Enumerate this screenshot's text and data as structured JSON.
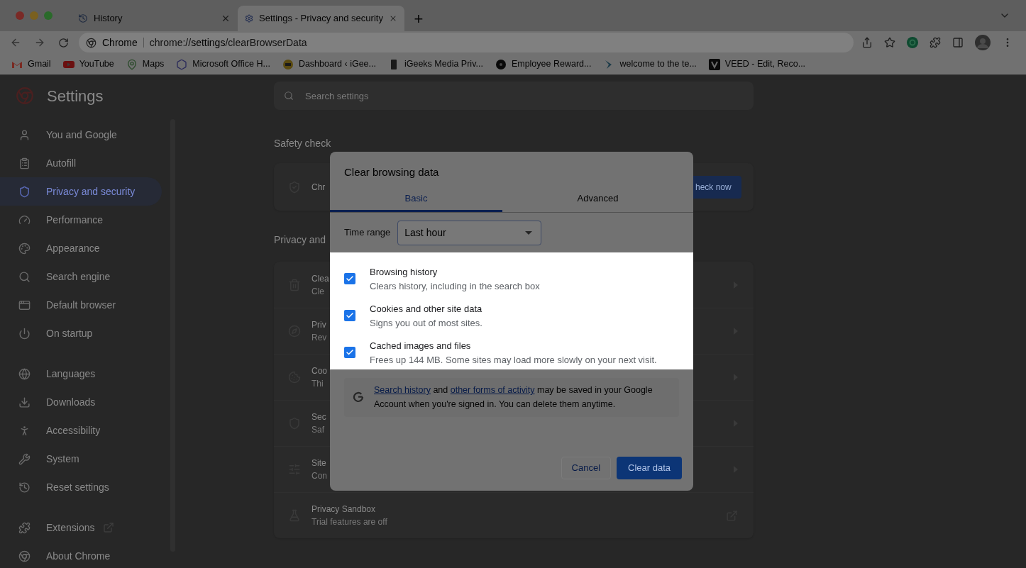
{
  "browser": {
    "tabs": [
      {
        "title": "History",
        "selected": false
      },
      {
        "title": "Settings - Privacy and security",
        "selected": true
      }
    ],
    "new_tab": "+",
    "address": {
      "site": "Chrome",
      "url": "chrome://**settings**/clearBrowserData"
    },
    "bookmarks": [
      {
        "title": "Gmail"
      },
      {
        "title": "YouTube"
      },
      {
        "title": "Maps"
      },
      {
        "title": "Microsoft Office H..."
      },
      {
        "title": "Dashboard ‹ iGee..."
      },
      {
        "title": "iGeeks Media Priv..."
      },
      {
        "title": "Employee Reward..."
      },
      {
        "title": "welcome to the te..."
      },
      {
        "title": "VEED - Edit, Reco..."
      }
    ]
  },
  "settings": {
    "title": "Settings",
    "search_placeholder": "Search settings",
    "sidebar_groups": [
      [
        {
          "label": "You and Google",
          "selected": false,
          "external": false
        },
        {
          "label": "Autofill",
          "selected": false,
          "external": false
        },
        {
          "label": "Privacy and security",
          "selected": true,
          "external": false
        },
        {
          "label": "Performance",
          "selected": false,
          "external": false
        },
        {
          "label": "Appearance",
          "selected": false,
          "external": false
        },
        {
          "label": "Search engine",
          "selected": false,
          "external": false
        },
        {
          "label": "Default browser",
          "selected": false,
          "external": false
        },
        {
          "label": "On startup",
          "selected": false,
          "external": false
        }
      ],
      [
        {
          "label": "Languages",
          "selected": false,
          "external": false
        },
        {
          "label": "Downloads",
          "selected": false,
          "external": false
        },
        {
          "label": "Accessibility",
          "selected": false,
          "external": false
        },
        {
          "label": "System",
          "selected": false,
          "external": false
        },
        {
          "label": "Reset settings",
          "selected": false,
          "external": false
        }
      ],
      [
        {
          "label": "Extensions",
          "selected": false,
          "external": true
        },
        {
          "label": "About Chrome",
          "selected": false,
          "external": false
        }
      ]
    ],
    "safety_check": {
      "heading": "Safety check",
      "row_title": "Chr",
      "button": "heck now"
    },
    "privacy": {
      "heading": "Privacy and",
      "rows": [
        {
          "title": "Clea",
          "subtitle": "Cle",
          "kind": "arrow"
        },
        {
          "title": "Priv",
          "subtitle": "Rev",
          "kind": "arrow"
        },
        {
          "title": "Coo",
          "subtitle": "Thi",
          "kind": "arrow"
        },
        {
          "title": "Sec",
          "subtitle": "Saf",
          "kind": "arrow"
        },
        {
          "title": "Site",
          "subtitle": "Con",
          "kind": "arrow"
        },
        {
          "title": "Privacy Sandbox",
          "subtitle": "Trial features are off",
          "kind": "external"
        }
      ]
    }
  },
  "dialog": {
    "title": "Clear browsing data",
    "tabs": [
      {
        "label": "Basic",
        "selected": true
      },
      {
        "label": "Advanced",
        "selected": false
      }
    ],
    "time_range": {
      "label": "Time range",
      "value": "Last hour"
    },
    "options": [
      {
        "title": "Browsing history",
        "description": "Clears history, including in the search box",
        "checked": true
      },
      {
        "title": "Cookies and other site data",
        "description": "Signs you out of most sites.",
        "checked": true
      },
      {
        "title": "Cached images and files",
        "description": "Frees up 144 MB. Some sites may load more slowly on your next visit.",
        "checked": true
      }
    ],
    "info": [
      {
        "kind": "link",
        "text": "Search history"
      },
      {
        "kind": "text",
        "text": " and "
      },
      {
        "kind": "link",
        "text": "other forms of activity"
      },
      {
        "kind": "text",
        "text": " may be saved in your Google Account when you're signed in. You can delete them anytime."
      }
    ],
    "buttons": {
      "cancel": "Cancel",
      "confirm": "Clear data"
    }
  }
}
